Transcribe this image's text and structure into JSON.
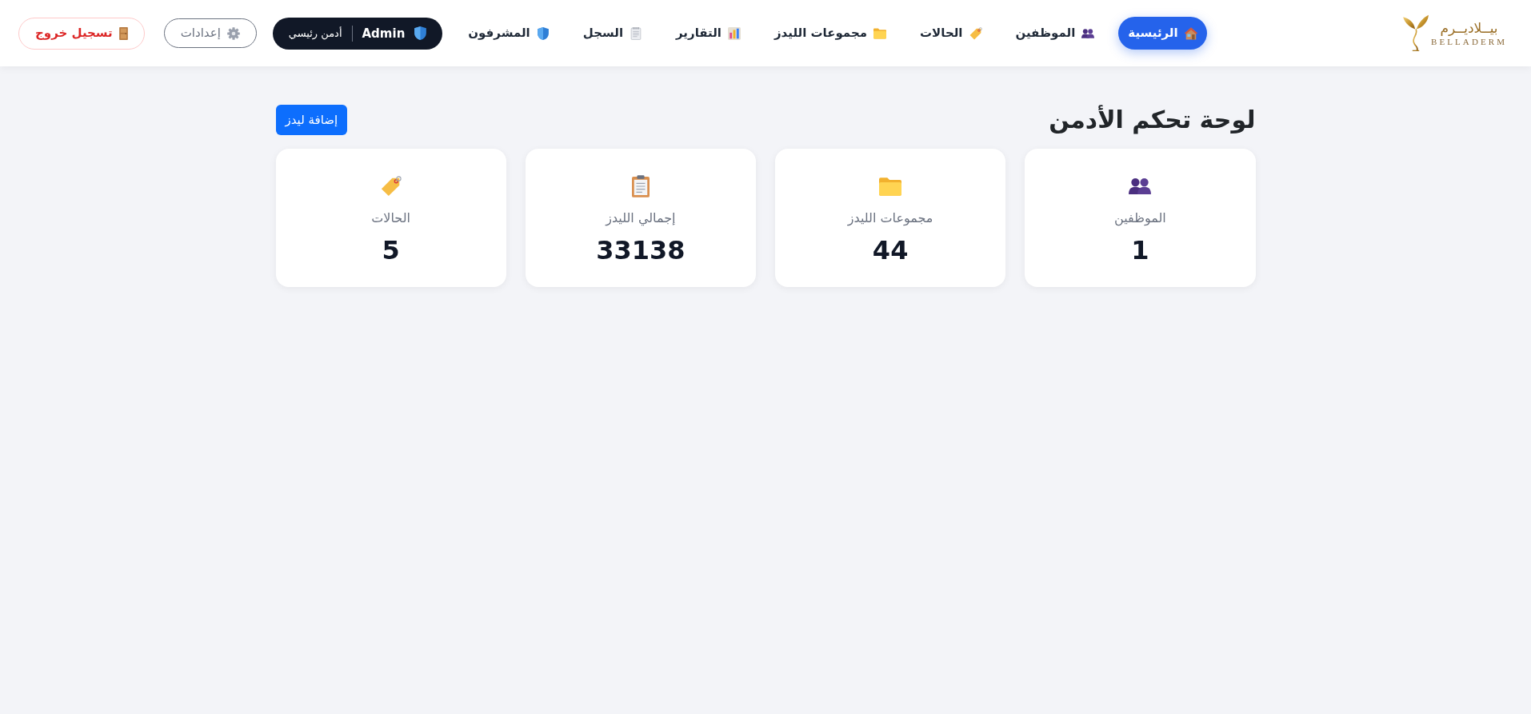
{
  "logo": {
    "name": "بيــلاديــرم",
    "subtitle": "BELLADERM"
  },
  "nav": {
    "items": [
      {
        "label": "الرئيسية",
        "selected": true
      },
      {
        "label": "الموظفين",
        "selected": false
      },
      {
        "label": "الحالات",
        "selected": false
      },
      {
        "label": "مجموعات الليدز",
        "selected": false
      },
      {
        "label": "التقارير",
        "selected": false
      },
      {
        "label": "السجل",
        "selected": false
      },
      {
        "label": "المشرفون",
        "selected": false
      }
    ]
  },
  "account": {
    "badge": {
      "role": "Admin",
      "name": "أدمن رئيسي"
    },
    "settings_button": "إعدادات",
    "logout_button": "تسجيل خروج"
  },
  "page": {
    "title": "لوحة تحكم الأدمن",
    "add_button": "إضافة ليدز"
  },
  "stats": [
    {
      "label": "الموظفين",
      "value": "1"
    },
    {
      "label": "مجموعات الليدز",
      "value": "44"
    },
    {
      "label": "إجمالي الليدز",
      "value": "33138"
    },
    {
      "label": "الحالات",
      "value": "5"
    }
  ]
}
